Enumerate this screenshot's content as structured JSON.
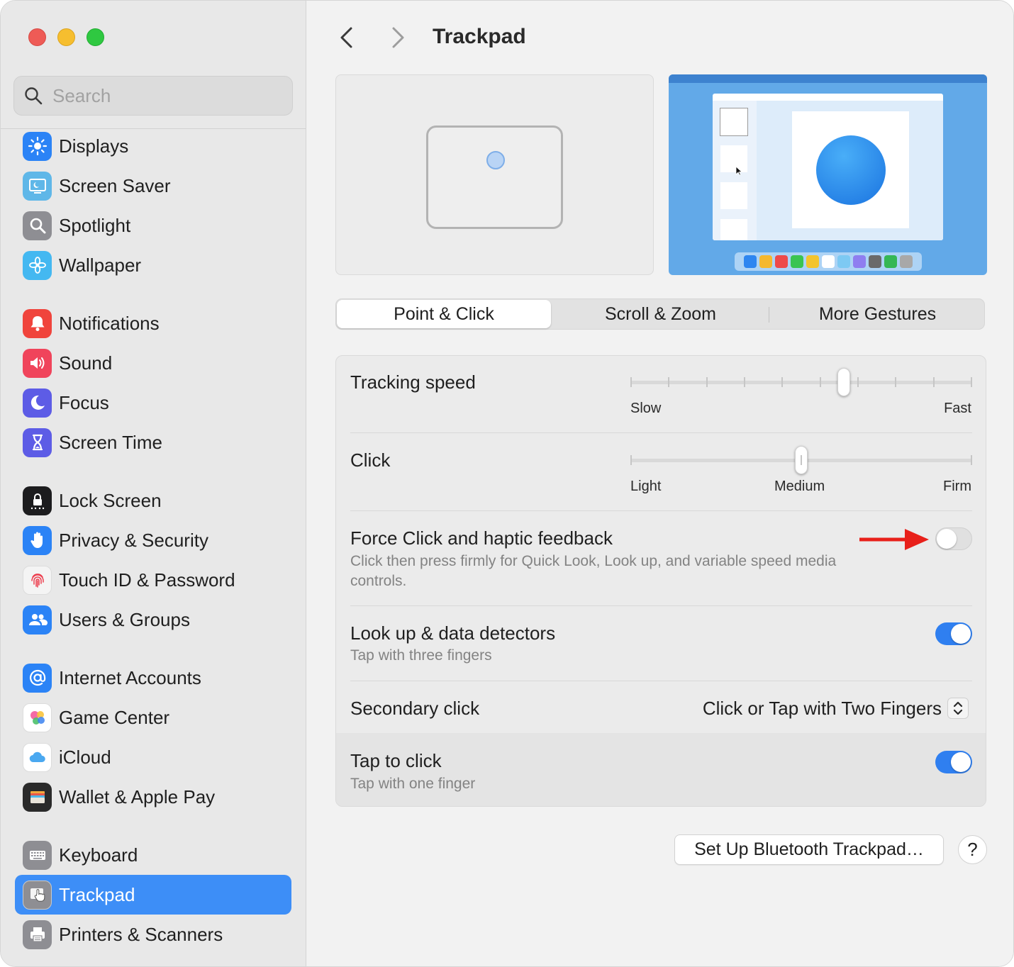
{
  "window": {
    "traffic_lights": [
      "close",
      "minimize",
      "maximize"
    ]
  },
  "sidebar": {
    "search_placeholder": "Search",
    "items": [
      {
        "label": "Displays",
        "icon": "sun-icon",
        "color": "#2b83f6"
      },
      {
        "label": "Screen Saver",
        "icon": "screen-saver-icon",
        "color": "#5fb7e8"
      },
      {
        "label": "Spotlight",
        "icon": "magnifier-icon",
        "color": "#8e8e93"
      },
      {
        "label": "Wallpaper",
        "icon": "flower-icon",
        "color": "#44b8f1"
      },
      {
        "label": "Notifications",
        "icon": "bell-icon",
        "color": "#f0443c"
      },
      {
        "label": "Sound",
        "icon": "speaker-icon",
        "color": "#f0445b"
      },
      {
        "label": "Focus",
        "icon": "moon-icon",
        "color": "#5d5ce6"
      },
      {
        "label": "Screen Time",
        "icon": "hourglass-icon",
        "color": "#5d5ce6"
      },
      {
        "label": "Lock Screen",
        "icon": "lock-icon",
        "color": "#1c1c1e"
      },
      {
        "label": "Privacy & Security",
        "icon": "hand-icon",
        "color": "#2b83f6"
      },
      {
        "label": "Touch ID & Password",
        "icon": "fingerprint-icon",
        "color": "#f4f4f4"
      },
      {
        "label": "Users & Groups",
        "icon": "users-icon",
        "color": "#2b83f6"
      },
      {
        "label": "Internet Accounts",
        "icon": "at-icon",
        "color": "#2b83f6"
      },
      {
        "label": "Game Center",
        "icon": "game-center-icon",
        "color": "#ffffff"
      },
      {
        "label": "iCloud",
        "icon": "cloud-icon",
        "color": "#ffffff"
      },
      {
        "label": "Wallet & Apple Pay",
        "icon": "wallet-icon",
        "color": "#2a2a2a"
      },
      {
        "label": "Keyboard",
        "icon": "keyboard-icon",
        "color": "#8e8e93"
      },
      {
        "label": "Trackpad",
        "icon": "trackpad-icon",
        "color": "#8e8e93",
        "selected": true
      },
      {
        "label": "Printers & Scanners",
        "icon": "printer-icon",
        "color": "#8e8e93"
      }
    ]
  },
  "header": {
    "title": "Trackpad",
    "back": "back-chevron",
    "forward": "forward-chevron"
  },
  "tabs": [
    {
      "label": "Point & Click",
      "active": true
    },
    {
      "label": "Scroll & Zoom",
      "active": false
    },
    {
      "label": "More Gestures",
      "active": false
    }
  ],
  "settings": {
    "tracking_speed": {
      "label": "Tracking speed",
      "min_label": "Slow",
      "max_label": "Fast",
      "level": 0.625,
      "ticks": 10
    },
    "click": {
      "label": "Click",
      "labels": [
        "Light",
        "Medium",
        "Firm"
      ],
      "level": 0.5
    },
    "force_click": {
      "label": "Force Click and haptic feedback",
      "description": "Click then press firmly for Quick Look, Look up, and variable speed media controls.",
      "on": false
    },
    "look_up": {
      "label": "Look up & data detectors",
      "description": "Tap with three fingers",
      "on": true
    },
    "secondary_click": {
      "label": "Secondary click",
      "value": "Click or Tap with Two Fingers"
    },
    "tap_to_click": {
      "label": "Tap to click",
      "description": "Tap with one finger",
      "on": true
    }
  },
  "footer": {
    "setup_button": "Set Up Bluetooth Trackpad…",
    "help_button": "?"
  },
  "colors": {
    "accent": "#3d8ef7",
    "toggle_on": "#2f7ff0",
    "annotation_arrow": "#e8201a"
  }
}
